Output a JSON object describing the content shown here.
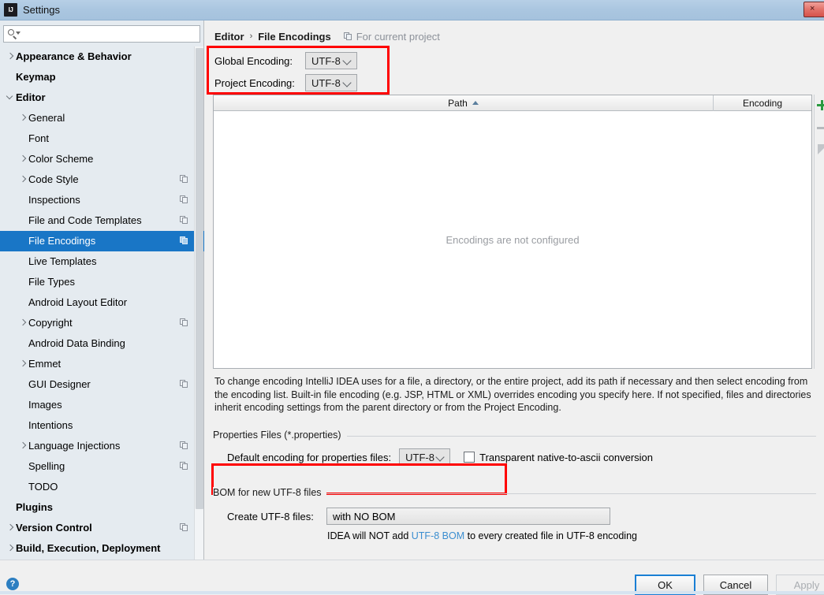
{
  "window": {
    "title": "Settings",
    "logo_text": "IJ",
    "close_label": "×"
  },
  "sidebar": {
    "search": {
      "placeholder": "",
      "value": "",
      "icon": "search-icon"
    },
    "items": [
      {
        "label": "Appearance & Behavior",
        "level": 0,
        "bold": true,
        "arrow": "right",
        "badge": false
      },
      {
        "label": "Keymap",
        "level": 0,
        "bold": true,
        "arrow": "none",
        "badge": false
      },
      {
        "label": "Editor",
        "level": 0,
        "bold": true,
        "arrow": "down",
        "badge": false
      },
      {
        "label": "General",
        "level": 1,
        "bold": false,
        "arrow": "right",
        "badge": false
      },
      {
        "label": "Font",
        "level": 1,
        "bold": false,
        "arrow": "none",
        "badge": false
      },
      {
        "label": "Color Scheme",
        "level": 1,
        "bold": false,
        "arrow": "right",
        "badge": false
      },
      {
        "label": "Code Style",
        "level": 1,
        "bold": false,
        "arrow": "right",
        "badge": true
      },
      {
        "label": "Inspections",
        "level": 1,
        "bold": false,
        "arrow": "none",
        "badge": true
      },
      {
        "label": "File and Code Templates",
        "level": 1,
        "bold": false,
        "arrow": "none",
        "badge": true
      },
      {
        "label": "File Encodings",
        "level": 1,
        "bold": false,
        "arrow": "none",
        "badge": true,
        "selected": true
      },
      {
        "label": "Live Templates",
        "level": 1,
        "bold": false,
        "arrow": "none",
        "badge": false
      },
      {
        "label": "File Types",
        "level": 1,
        "bold": false,
        "arrow": "none",
        "badge": false
      },
      {
        "label": "Android Layout Editor",
        "level": 1,
        "bold": false,
        "arrow": "none",
        "badge": false
      },
      {
        "label": "Copyright",
        "level": 1,
        "bold": false,
        "arrow": "right",
        "badge": true
      },
      {
        "label": "Android Data Binding",
        "level": 1,
        "bold": false,
        "arrow": "none",
        "badge": false
      },
      {
        "label": "Emmet",
        "level": 1,
        "bold": false,
        "arrow": "right",
        "badge": false
      },
      {
        "label": "GUI Designer",
        "level": 1,
        "bold": false,
        "arrow": "none",
        "badge": true
      },
      {
        "label": "Images",
        "level": 1,
        "bold": false,
        "arrow": "none",
        "badge": false
      },
      {
        "label": "Intentions",
        "level": 1,
        "bold": false,
        "arrow": "none",
        "badge": false
      },
      {
        "label": "Language Injections",
        "level": 1,
        "bold": false,
        "arrow": "right",
        "badge": true
      },
      {
        "label": "Spelling",
        "level": 1,
        "bold": false,
        "arrow": "none",
        "badge": true
      },
      {
        "label": "TODO",
        "level": 1,
        "bold": false,
        "arrow": "none",
        "badge": false
      },
      {
        "label": "Plugins",
        "level": 0,
        "bold": true,
        "arrow": "none",
        "badge": false
      },
      {
        "label": "Version Control",
        "level": 0,
        "bold": true,
        "arrow": "right",
        "badge": true
      },
      {
        "label": "Build, Execution, Deployment",
        "level": 0,
        "bold": true,
        "arrow": "right",
        "badge": false
      }
    ]
  },
  "main": {
    "breadcrumb": {
      "parent": "Editor",
      "separator": "›",
      "current": "File Encodings"
    },
    "scope_badge": "For current project",
    "global_encoding": {
      "label": "Global Encoding:",
      "value": "UTF-8"
    },
    "project_encoding": {
      "label": "Project Encoding:",
      "value": "UTF-8"
    },
    "table": {
      "columns": [
        "Path",
        "Encoding"
      ],
      "sort_column": "Path",
      "sort_direction": "asc",
      "rows": [],
      "empty_message": "Encodings are not configured"
    },
    "table_tools": [
      {
        "name": "add-encoding-button",
        "icon": "plus-icon"
      },
      {
        "name": "remove-encoding-button",
        "icon": "minus-icon"
      },
      {
        "name": "edit-encoding-button",
        "icon": "pencil-icon"
      }
    ],
    "description": "To change encoding IntelliJ IDEA uses for a file, a directory, or the entire project, add its path if necessary and then select encoding from the encoding list. Built-in file encoding (e.g. JSP, HTML or XML) overrides encoding you specify here. If not specified, files and directories inherit encoding settings from the parent directory or from the Project Encoding.",
    "properties_group": {
      "title": "Properties Files (*.properties)",
      "default_encoding_label": "Default encoding for properties files:",
      "default_encoding_value": "UTF-8",
      "transparent_label": "Transparent native-to-ascii conversion",
      "transparent_checked": false
    },
    "bom_group": {
      "title": "BOM for new UTF-8 files",
      "create_label": "Create UTF-8 files:",
      "create_value": "with NO BOM",
      "note_prefix": "IDEA will NOT add ",
      "note_link": "UTF-8 BOM",
      "note_suffix": " to every created file in UTF-8 encoding"
    }
  },
  "footer": {
    "help_icon_label": "?",
    "ok_label": "OK",
    "cancel_label": "Cancel",
    "apply_label": "Apply"
  },
  "colors": {
    "highlight": "#ff0000",
    "selection": "#1976c6",
    "link": "#3b8ed0",
    "accent_green": "#2a9a3f"
  }
}
